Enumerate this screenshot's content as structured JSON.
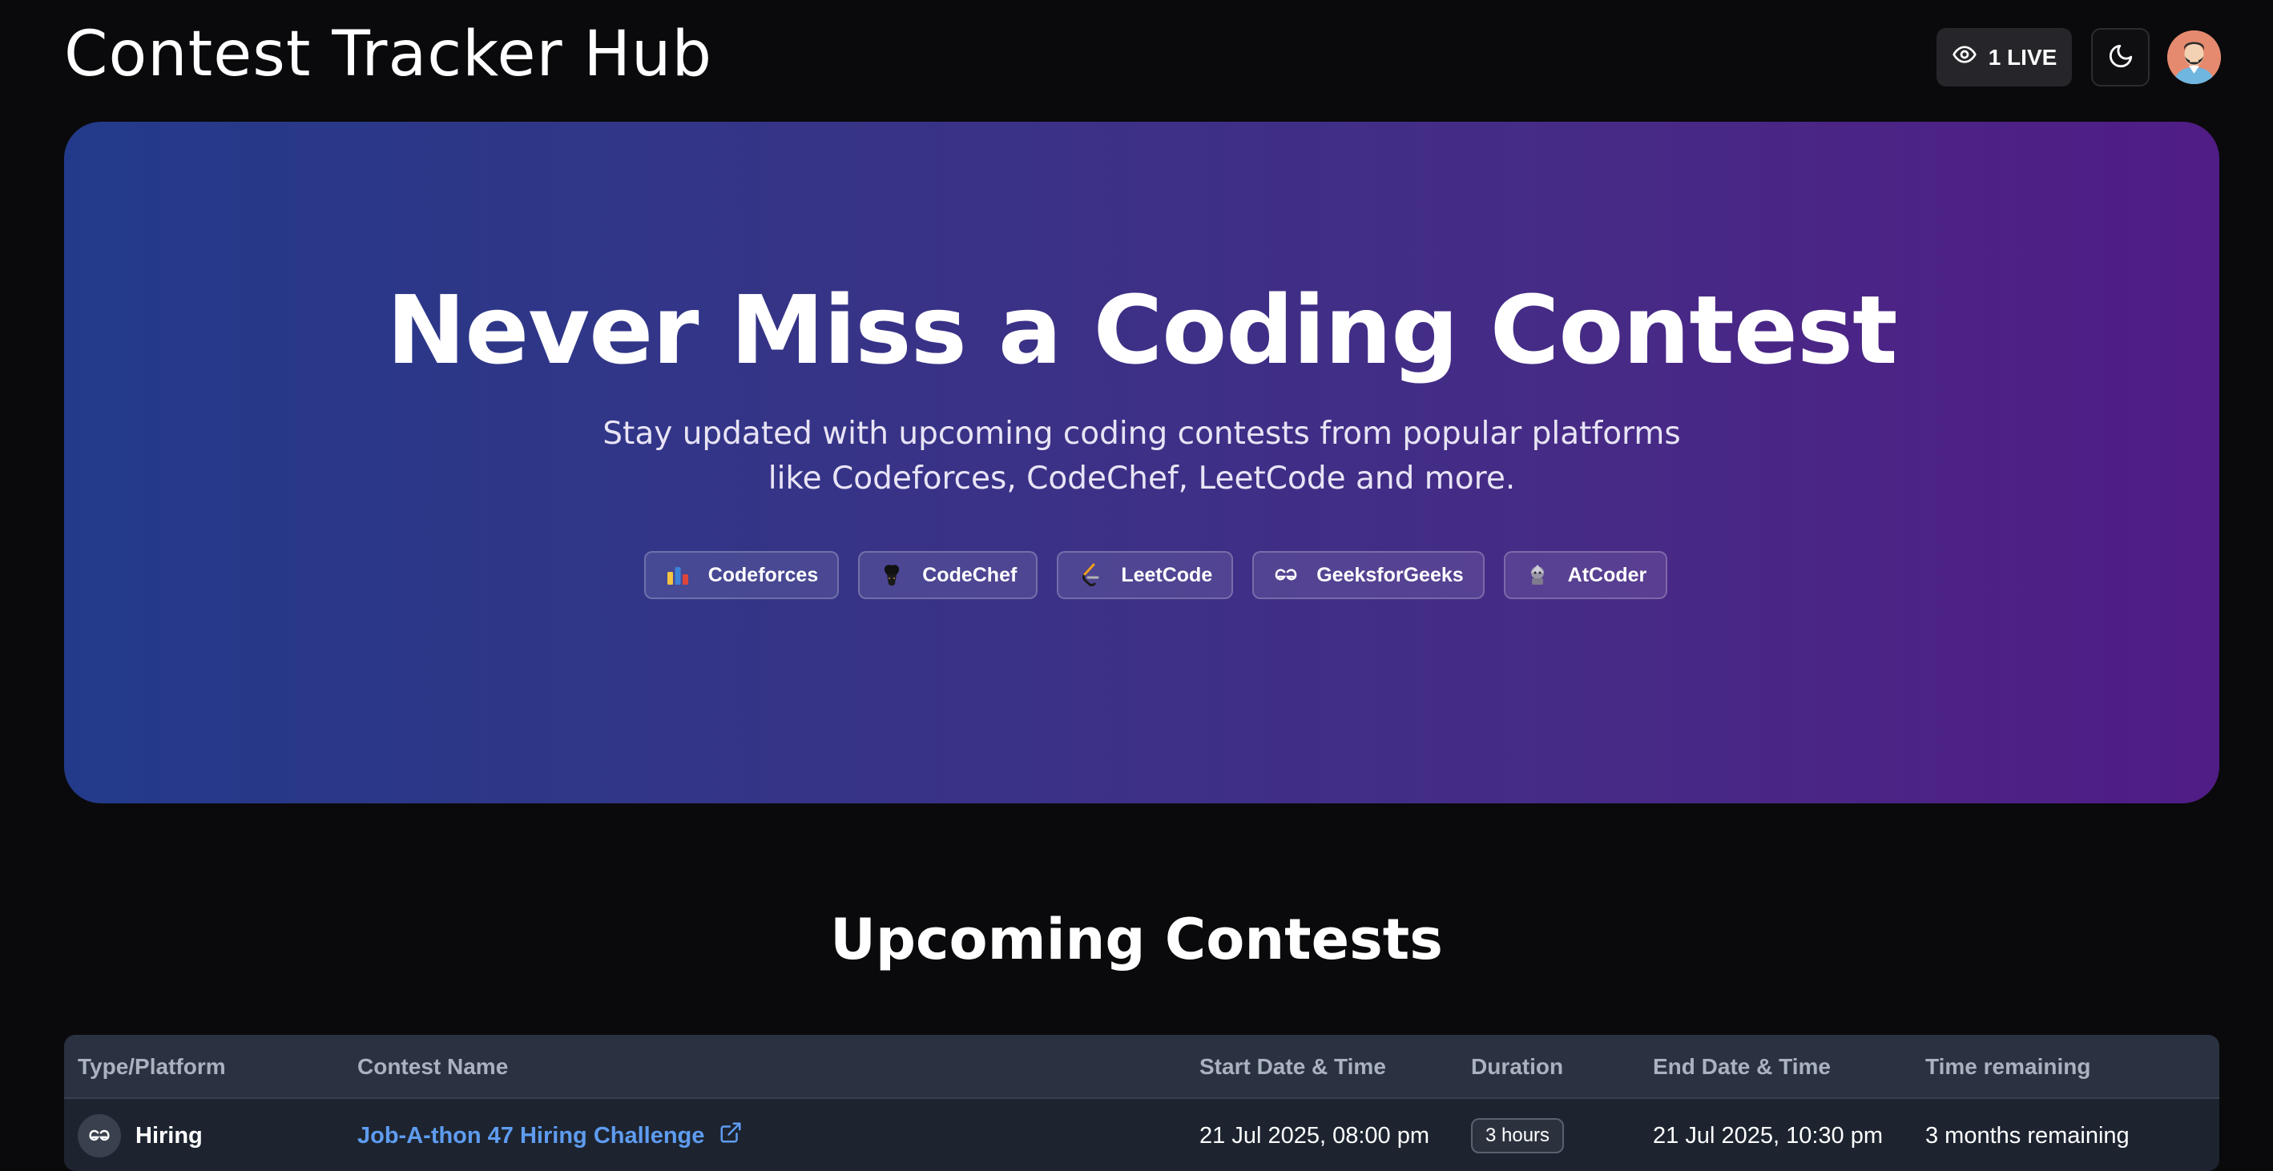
{
  "header": {
    "app_title": "Contest Tracker Hub",
    "live_label": "1 LIVE",
    "icons": {
      "live": "eye-icon",
      "theme": "moon-icon",
      "avatar": "user-avatar"
    }
  },
  "hero": {
    "title": "Never Miss a Coding Contest",
    "subtitle": "Stay updated with upcoming coding contests from popular platforms like Codeforces, CodeChef, LeetCode and more.",
    "platforms": [
      {
        "label": "Codeforces",
        "icon": "codeforces-icon"
      },
      {
        "label": "CodeChef",
        "icon": "codechef-icon"
      },
      {
        "label": "LeetCode",
        "icon": "leetcode-icon"
      },
      {
        "label": "GeeksforGeeks",
        "icon": "geeksforgeeks-icon"
      },
      {
        "label": "AtCoder",
        "icon": "atcoder-icon"
      }
    ]
  },
  "contests": {
    "title": "Upcoming Contests",
    "columns": [
      "Type/Platform",
      "Contest Name",
      "Start Date & Time",
      "Duration",
      "End Date & Time",
      "Time remaining"
    ],
    "rows": [
      {
        "platform": "Hiring",
        "platform_icon": "geeksforgeeks-icon",
        "name": "Job-A-thon 47 Hiring Challenge",
        "start": "21 Jul 2025, 08:00 pm",
        "duration": "3 hours",
        "end": "21 Jul 2025, 10:30 pm",
        "remaining": "3 months remaining"
      }
    ]
  },
  "colors": {
    "background": "#0a0a0c",
    "hero_gradient_start": "#233a8a",
    "hero_gradient_end": "#501c86",
    "link": "#5e9cf0",
    "table_header": "#2a3140",
    "table_body": "#1d2430"
  }
}
